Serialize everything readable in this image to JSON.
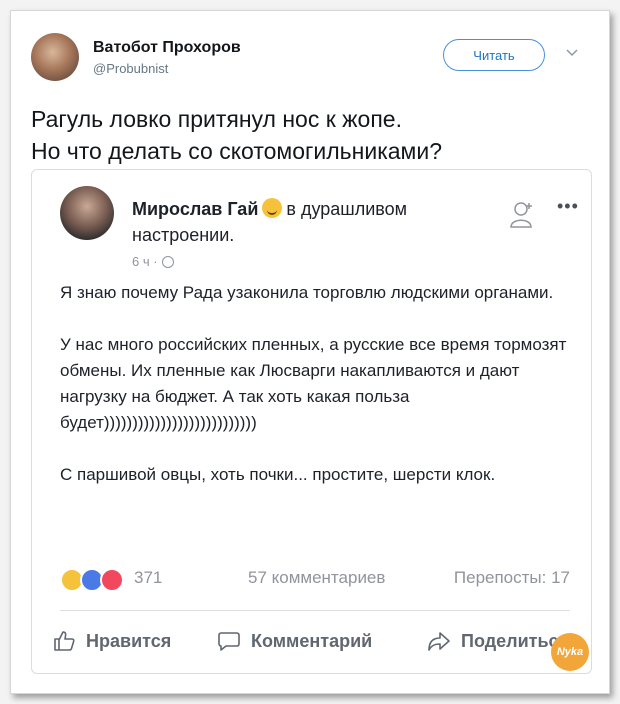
{
  "tweet": {
    "author_name": "Ватобот Прохоров",
    "author_handle": "@Probubnist",
    "follow_label": "Читать",
    "text_line1": "Рагуль ловко притянул нос к жопе.",
    "text_line2": "Но что делать со скотомогильниками?"
  },
  "fb_post": {
    "author_name": "Мирослав Гай",
    "mood_text_1": "в дурашливом",
    "mood_text_2": "настроении.",
    "time": "6 ч ·",
    "more_label": "•••",
    "paragraphs": [
      "Я знаю почему Рада узаконила торговлю людскими органами.",
      "У нас много российских пленных, а русские все время тормозят обмены. Их пленные как Люсварги накапливаются и дают нагрузку на бюджет. А так хоть какая польза будет)))))))))))))))))))))))))))",
      "С паршивой овцы, хоть почки... простите, шерсти клок."
    ],
    "reaction_count": "371",
    "comments_text": "57 комментариев",
    "shares_text": "Перепосты: 17",
    "actions": {
      "like": "Нравится",
      "comment": "Комментарий",
      "share": "Поделиться"
    }
  },
  "watermark": "Nyka",
  "colors": {
    "follow_blue": "#1d74c4",
    "fb_grey": "#606770"
  }
}
